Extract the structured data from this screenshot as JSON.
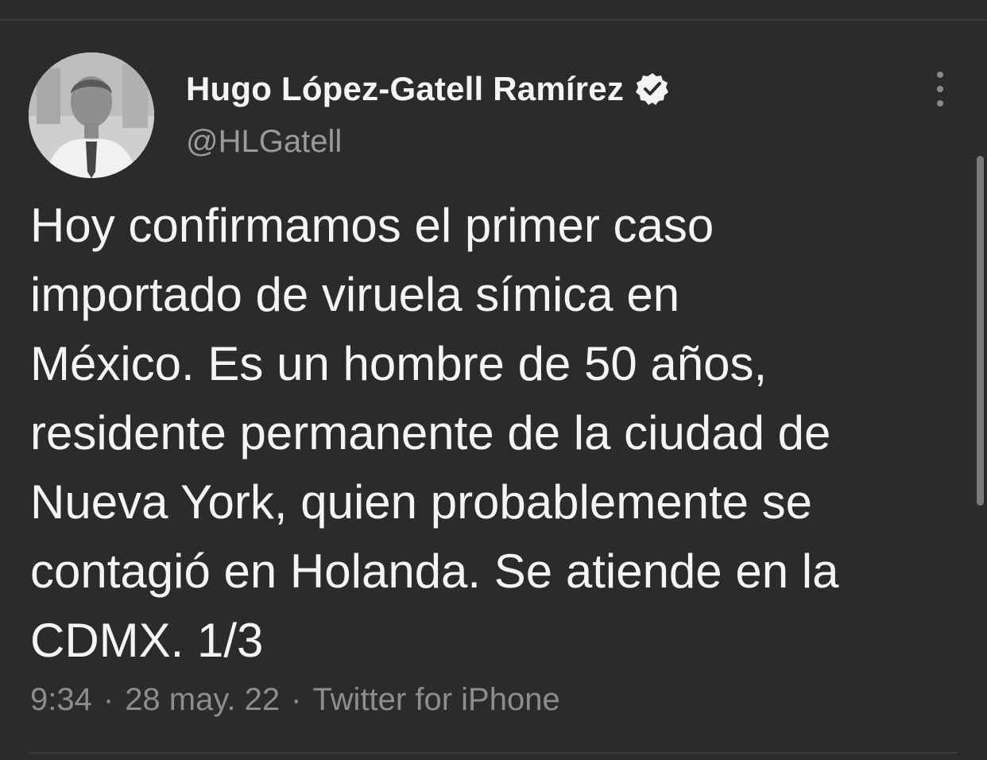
{
  "author": {
    "display_name": "Hugo López-Gatell Ramírez",
    "handle": "@HLGatell",
    "verified": true
  },
  "tweet": {
    "lines": [
      "Hoy confirmamos el primer caso",
      "importado de viruela símica en",
      "México. Es un hombre de 50 años,",
      "residente permanente de la ciudad de",
      "Nueva York, quien probablemente se",
      "contagió en Holanda. Se atiende en la",
      "CDMX. 1/3"
    ]
  },
  "meta": {
    "time": "9:34",
    "date": "28 may. 22",
    "source": "Twitter for iPhone",
    "separator": "·"
  },
  "icons": {
    "verified": "verified-badge-icon",
    "more": "more-options-icon"
  }
}
